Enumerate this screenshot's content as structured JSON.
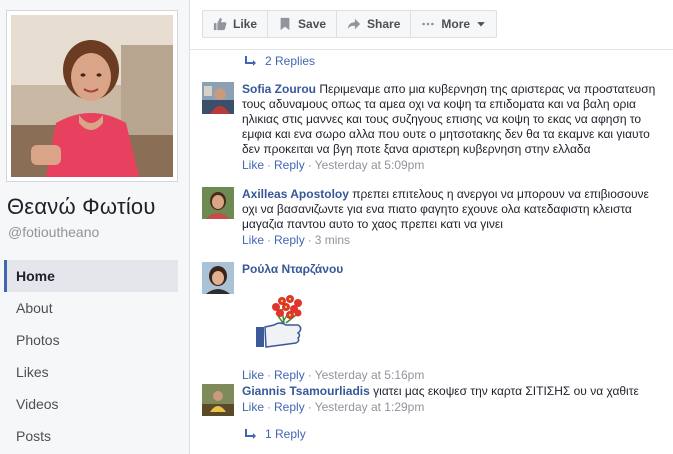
{
  "sidebar": {
    "page_name": "Θεανώ Φωτίου",
    "handle": "@fotioutheano",
    "nav": [
      {
        "label": "Home",
        "active": true
      },
      {
        "label": "About"
      },
      {
        "label": "Photos"
      },
      {
        "label": "Likes"
      },
      {
        "label": "Videos"
      },
      {
        "label": "Posts"
      }
    ]
  },
  "actions": {
    "like": "Like",
    "save": "Save",
    "share": "Share",
    "more": "More"
  },
  "top_replies": "2 Replies",
  "comments": [
    {
      "author": "Sofia Zourou",
      "text": "Περιμεναμε απο μια κυβερνηση της αριστερας να προστατευση τους αδυναμους οπως τα αμεα οχι να κοψη τα επιδοματα και να βαλη ορια ηλικιας στις μαννες και τους συζηγους επισης να κοψη το εκας να αφηση το εμφια και ενα σωρο αλλα που ουτε ο μητσοτακης δεν θα τα εκαμνε και γιαυτο δεν προκειται να βγη ποτε ξανα αριστερη κυβερνηση στην ελλαδα",
      "like": "Like",
      "reply": "Reply",
      "time": "Yesterday at 5:09pm"
    },
    {
      "author": "Axilleas Apostoloy",
      "text": "πρεπει επιτελους η ανεργοι να μπορουν να επιβιοσουνε οχι να βασανιζωντε για ενα πιατο φαγητο εχουνε ολα κατεδαφιστη κλειστα μαγαζια παντου αυτο το χαος πρεπει κατι να γινει",
      "like": "Like",
      "reply": "Reply",
      "time": "3 mins"
    },
    {
      "author": "Ρούλα Νταρζάνου",
      "text": "",
      "like": "Like",
      "reply": "Reply",
      "time": "Yesterday at 5:16pm"
    },
    {
      "author": "Giannis Tsamourliadis",
      "text": "γιατει μας εκοψεσ την καρτα ΣΙΤΙΣΗΣ ου να χαθιτε",
      "like": "Like",
      "reply": "Reply",
      "time": "Yesterday at 1:29pm"
    }
  ],
  "bottom_replies": "1 Reply",
  "colors": {
    "link": "#4267b2",
    "author": "#365899",
    "meta": "#90949c",
    "background": "#e9ebee"
  },
  "icons": [
    "thumbs-up-icon",
    "bookmark-icon",
    "share-arrow-icon",
    "ellipsis-icon",
    "caret-down-icon",
    "reply-arrow-icon",
    "flower-like-sticker"
  ]
}
